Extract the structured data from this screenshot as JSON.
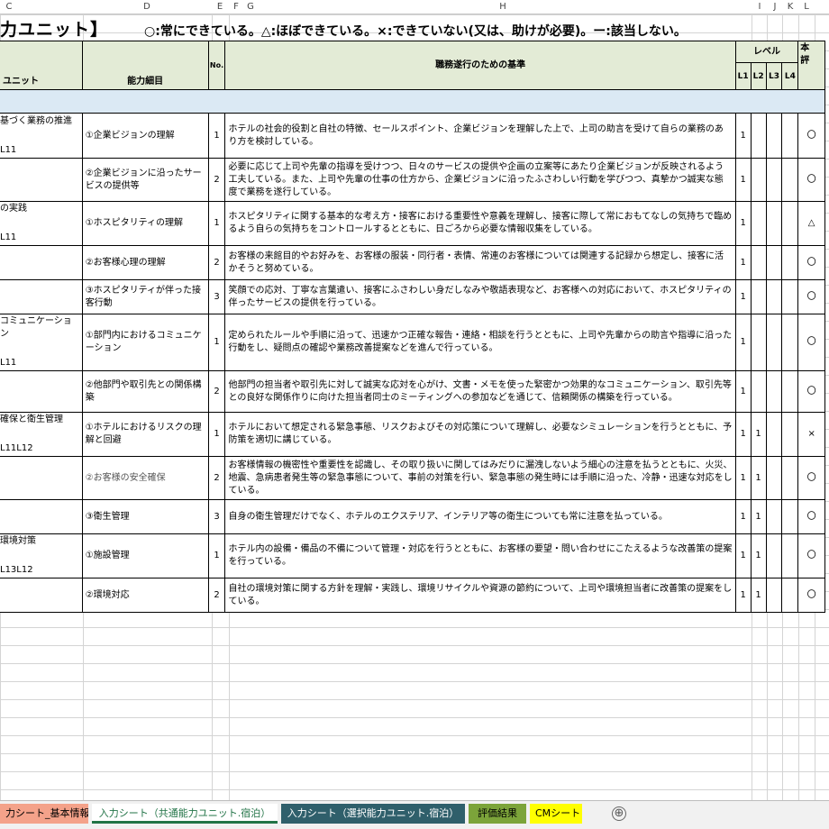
{
  "col_headers": [
    "C",
    "D",
    "E",
    "F",
    "G",
    "H",
    "I",
    "J",
    "K",
    "L"
  ],
  "title": "力ユニット】",
  "legend": "○:常にできている。△:ほぼできている。×:できていない(又は、助けが必要)。ー:該当しない。",
  "header": {
    "unit": "ユニット",
    "detail": "能力細目",
    "no": "No.",
    "criteria": "職務遂行のための基準",
    "level": "レベル",
    "l1": "L1",
    "l2": "L2",
    "l3": "L3",
    "l4": "L4",
    "eval": "本\n評"
  },
  "rows": [
    {
      "unit": "基づく業務の推進",
      "code": "L11",
      "detail": "①企業ビジョンの理解",
      "no": "1",
      "criteria": "ホテルの社会的役割と自社の特徴、セールスポイント、企業ビジョンを理解した上で、上司の助言を受けて自らの業務のあり方を検討している。",
      "l1": "1",
      "l2": "",
      "l3": "",
      "l4": "",
      "eval": "〇"
    },
    {
      "unit": "",
      "code": "",
      "detail": "②企業ビジョンに沿ったサービスの提供等",
      "no": "2",
      "criteria": "必要に応じて上司や先輩の指導を受けつつ、日々のサービスの提供や企画の立案等にあたり企業ビジョンが反映されるよう工夫している。また、上司や先輩の仕事の仕方から、企業ビジョンに沿ったふさわしい行動を学びつつ、真摯かつ誠実な態度で業務を遂行している。",
      "l1": "1",
      "l2": "",
      "l3": "",
      "l4": "",
      "eval": "〇"
    },
    {
      "unit": "の実践",
      "code": "L11",
      "detail": "①ホスピタリティの理解",
      "no": "1",
      "criteria": "ホスピタリティに関する基本的な考え方・接客における重要性や意義を理解し、接客に際して常におもてなしの気持ちで臨めるよう自らの気持ちをコントロールするとともに、日ごろから必要な情報収集をしている。",
      "l1": "1",
      "l2": "",
      "l3": "",
      "l4": "",
      "eval": "△"
    },
    {
      "unit": "",
      "code": "",
      "detail": "②お客様心理の理解",
      "no": "2",
      "criteria": "お客様の来館目的やお好みを、お客様の服装・同行者・表情、常連のお客様については関連する記録から想定し、接客に活かそうと努めている。",
      "l1": "1",
      "l2": "",
      "l3": "",
      "l4": "",
      "eval": "〇"
    },
    {
      "unit": "",
      "code": "",
      "detail": "③ホスピタリティが伴った接客行動",
      "no": "3",
      "criteria": "笑顔での応対、丁寧な言葉遣い、接客にふさわしい身だしなみや敬語表現など、お客様への対応において、ホスピタリティの伴ったサービスの提供を行っている。",
      "l1": "1",
      "l2": "",
      "l3": "",
      "l4": "",
      "eval": "〇"
    },
    {
      "unit": "コミュニケーション",
      "code": "L11",
      "detail": "①部門内におけるコミュニケーション",
      "no": "1",
      "criteria": "定められたルールや手順に沿って、迅速かつ正確な報告・連絡・相談を行うとともに、上司や先輩からの助言や指導に沿った行動をし、疑問点の確認や業務改善提案などを進んで行っている。",
      "l1": "1",
      "l2": "",
      "l3": "",
      "l4": "",
      "eval": "〇"
    },
    {
      "unit": "",
      "code": "",
      "detail": "②他部門や取引先との関係構築",
      "no": "2",
      "criteria": "他部門の担当者や取引先に対して誠実な応対を心がけ、文書・メモを使った緊密かつ効果的なコミュニケーション、取引先等との良好な関係作りに向けた担当者同士のミーティングへの参加などを通じて、信頼関係の構築を行っている。",
      "l1": "1",
      "l2": "",
      "l3": "",
      "l4": "",
      "eval": "〇"
    },
    {
      "unit": "確保と衛生管理",
      "code": "L11L12",
      "detail": "①ホテルにおけるリスクの理解と回避",
      "no": "1",
      "criteria": "ホテルにおいて想定される緊急事態、リスクおよびその対応策について理解し、必要なシミュレーションを行うとともに、予防策を適切に講じている。",
      "l1": "1",
      "l2": "1",
      "l3": "",
      "l4": "",
      "eval": "×"
    },
    {
      "unit": "",
      "code": "",
      "detail": "②お客様の安全確保",
      "no": "2",
      "criteria": "お客様情報の機密性や重要性を認識し、その取り扱いに関してはみだりに漏洩しないよう細心の注意を払うとともに、火災、地震、急病患者発生等の緊急事態について、事前の対策を行い、緊急事態の発生時には手順に沿った、冷静・迅速な対応をしている。",
      "l1": "1",
      "l2": "1",
      "l3": "",
      "l4": "",
      "eval": "〇"
    },
    {
      "unit": "",
      "code": "",
      "detail": "③衛生管理",
      "no": "3",
      "criteria": "自身の衛生管理だけでなく、ホテルのエクステリア、インテリア等の衛生についても常に注意を払っている。",
      "l1": "1",
      "l2": "1",
      "l3": "",
      "l4": "",
      "eval": "〇"
    },
    {
      "unit": "環境対策",
      "code": "L13L12",
      "detail": "①施設管理",
      "no": "1",
      "criteria": "ホテル内の設備・備品の不備について管理・対応を行うとともに、お客様の要望・問い合わせにこたえるような改善策の提案を行っている。",
      "l1": "1",
      "l2": "1",
      "l3": "",
      "l4": "",
      "eval": "〇"
    },
    {
      "unit": "",
      "code": "",
      "detail": "②環境対応",
      "no": "2",
      "criteria": "自社の環境対策に関する方針を理解・実践し、環境リサイクルや資源の節約について、上司や環境担当者に改善策の提案をしている。",
      "l1": "1",
      "l2": "1",
      "l3": "",
      "l4": "",
      "eval": "〇"
    }
  ],
  "tabs": [
    "力シート_基本情報",
    "入力シート（共通能力ユニット.宿泊）",
    "入力シート（選択能力ユニット.宿泊）",
    "評価結果",
    "CMシート"
  ],
  "add_tab": "⊕"
}
